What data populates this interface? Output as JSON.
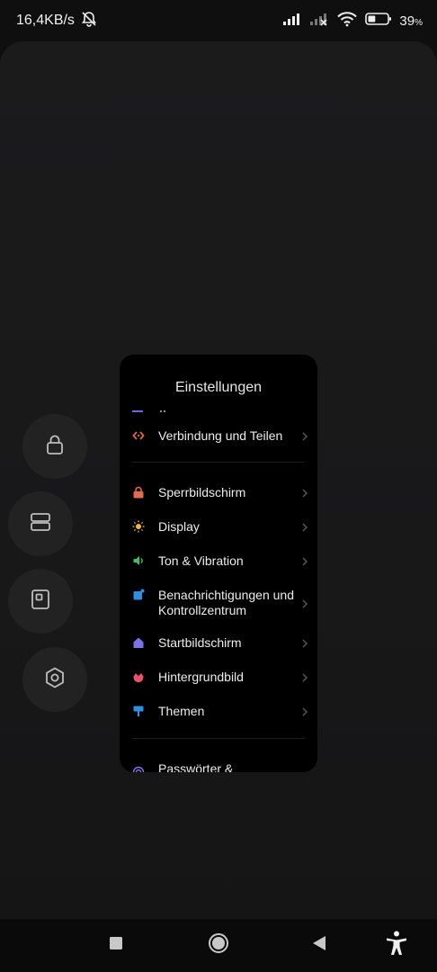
{
  "status_bar": {
    "net_speed": "16,4KB/s",
    "battery_percent": "39",
    "battery_unit": "%",
    "battery_level": 0.39,
    "icons": [
      "notifications-off-icon",
      "signal-icon",
      "signal-noservice-icon",
      "wifi-icon",
      "battery-icon"
    ]
  },
  "side_buttons": [
    {
      "name": "lock-icon"
    },
    {
      "name": "split-screen-icon"
    },
    {
      "name": "floating-window-icon"
    },
    {
      "name": "settings-hex-icon"
    }
  ],
  "window": {
    "title": "Einstellungen",
    "items": [
      {
        "label": "Verbindung und Teilen",
        "icon": "connection-share-icon",
        "color": "#e5654a"
      },
      {
        "label": "Sperrbildschirm",
        "icon": "lock-screen-icon",
        "color": "#e26a4f"
      },
      {
        "label": "Display",
        "icon": "display-sun-icon",
        "color": "#f2b53a"
      },
      {
        "label": "Ton & Vibration",
        "icon": "sound-icon",
        "color": "#3fbf6a"
      },
      {
        "label": "Benachrichtigungen und Kontrollzentrum",
        "icon": "notifications-icon",
        "color": "#2f8fe0"
      },
      {
        "label": "Startbildschirm",
        "icon": "home-icon",
        "color": "#7b72e8"
      },
      {
        "label": "Hintergrundbild",
        "icon": "wallpaper-icon",
        "color": "#e8526d"
      },
      {
        "label": "Themen",
        "icon": "themes-icon",
        "color": "#2f8fe0"
      },
      {
        "label": "Passwörter &",
        "icon": "passwords-icon",
        "color": "#8a70e8"
      }
    ]
  },
  "nav_bar": {
    "icons": [
      "recents-square-icon",
      "home-circle-icon",
      "back-triangle-icon",
      "accessibility-icon"
    ]
  }
}
